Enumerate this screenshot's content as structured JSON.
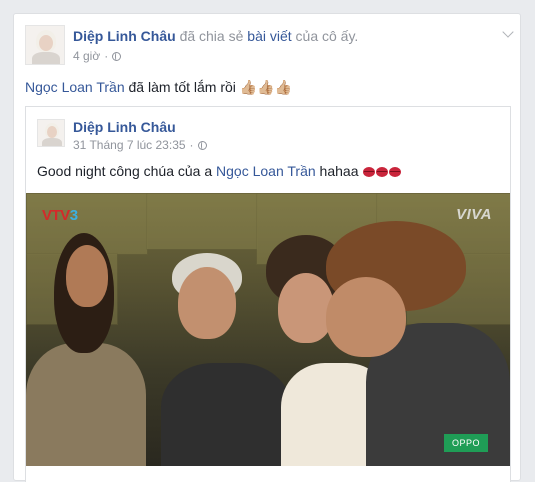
{
  "post": {
    "author": "Diệp Linh Châu",
    "action_text": "đã chia sẻ",
    "action_link": "bài viết",
    "action_suffix": "của cô ấy.",
    "time": "4 giờ",
    "mention": "Ngọc Loan Trần",
    "message": "đã làm tốt lắm rồi",
    "emoji_thumbs": "👍🏼👍🏼👍🏼"
  },
  "shared": {
    "author": "Diệp Linh Châu",
    "time": "31 Tháng 7 lúc 23:35",
    "text_prefix": "Good night công chúa của a",
    "mention": "Ngọc Loan Trần",
    "text_suffix": "hahaa"
  },
  "video": {
    "logo_left_a": "VTV",
    "logo_left_b": "3",
    "logo_right": "VIVA",
    "sponsor": "OPPO"
  },
  "icons": {
    "globe": "globe-icon",
    "options": "chevron-down-icon",
    "thumbs": "thumbs-up-icon",
    "kiss": "kiss-mark-icon"
  },
  "colors": {
    "link": "#365899",
    "muted": "#90949c",
    "background": "#e9ebee"
  }
}
